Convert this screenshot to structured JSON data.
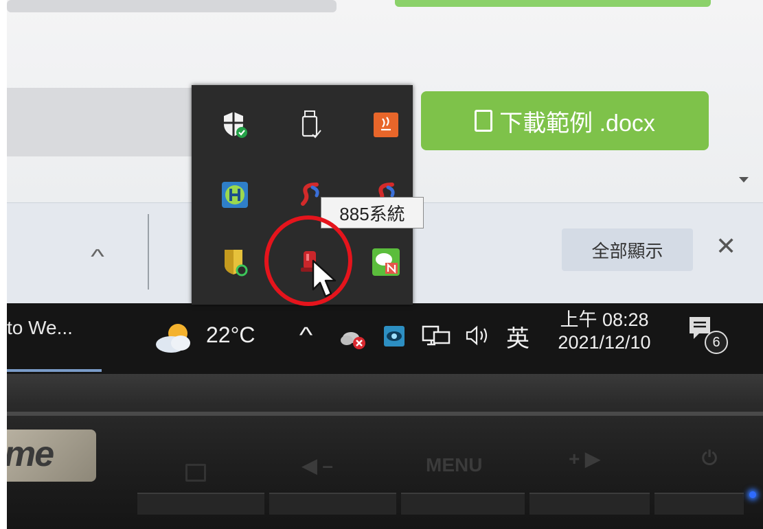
{
  "page": {
    "download_button_label": "下載範例 .docx",
    "show_all_label": "全部顯示",
    "close_symbol": "✕",
    "collapse_symbol": "^"
  },
  "tray_popup": {
    "tooltip": "885系統",
    "icons": [
      "windows-security-icon",
      "usb-eject-icon",
      "java-update-icon",
      "h-app-icon",
      "s-app-icon",
      "s-app-icon-2",
      "shield-app-icon",
      "885-system-icon",
      "chat-n-icon"
    ]
  },
  "taskbar": {
    "app_label": "to We...",
    "temperature": "22°C",
    "tray_chevron": "^",
    "ime": "英",
    "time": "上午 08:28",
    "date": "2021/12/10",
    "notification_count": "6"
  },
  "bezel": {
    "brand": "me",
    "menu_label": "MENU",
    "arrows_label": "◀ –",
    "plus_label": "+ ▶",
    "power_symbol": "⏻"
  },
  "colors": {
    "download_green": "#7ec24a",
    "highlight_red": "#e5141c",
    "taskbar": "#151515"
  }
}
